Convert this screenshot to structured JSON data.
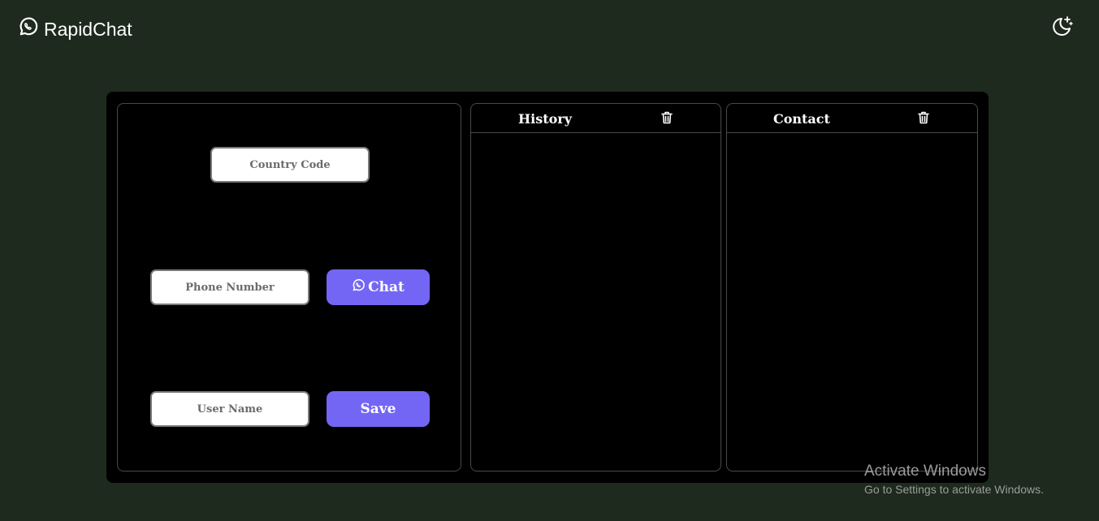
{
  "app": {
    "name": "RapidChat",
    "logo_icon": "whatsapp-icon"
  },
  "header": {
    "theme_toggle_icon": "moon-stars-icon"
  },
  "form": {
    "country_code_placeholder": "Country Code",
    "phone_number_placeholder": "Phone Number",
    "user_name_placeholder": "User Name",
    "chat_label": "Chat",
    "chat_icon": "whatsapp-icon",
    "save_label": "Save"
  },
  "history": {
    "title": "History",
    "clear_icon": "trash-icon",
    "items": []
  },
  "contact": {
    "title": "Contact",
    "clear_icon": "trash-icon",
    "items": []
  },
  "watermark": {
    "title": "Activate Windows",
    "subtitle": "Go to Settings to activate Windows."
  },
  "colors": {
    "background": "#1f2a1e",
    "card": "#000000",
    "accent": "#7466f5",
    "border": "#4a4a4a"
  }
}
